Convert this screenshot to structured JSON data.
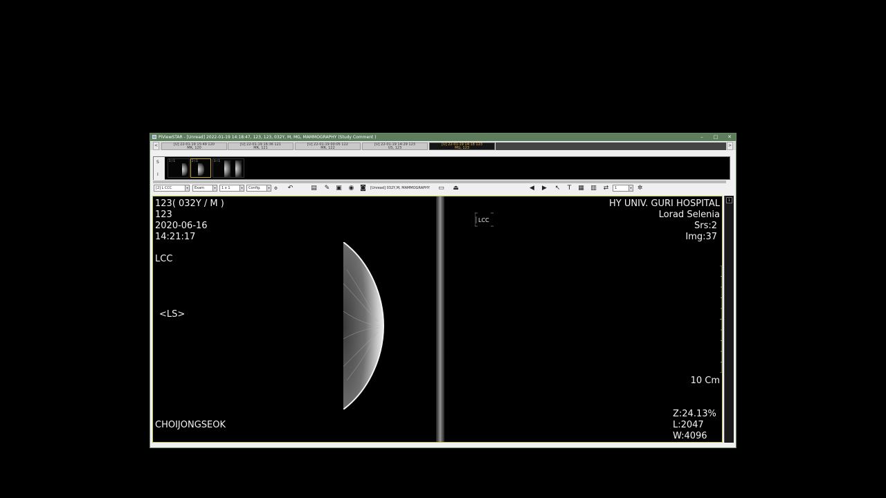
{
  "window": {
    "title": "PiViewSTAR - [Unread] 2022-01-19 14:18:47, 123, 123, 032Y, M, MG, MAMMOGRAPHY  (Study Comment )",
    "minimize": "–",
    "maximize": "□",
    "close": "✕"
  },
  "tabs": [
    {
      "line1": "[U] 22-01-19 15:49  120",
      "line2": "MR, 120",
      "active": false
    },
    {
      "line1": "[U] 22-01-19 16:36  121",
      "line2": "MR, 121",
      "active": false
    },
    {
      "line1": "[U] 22-01-19 00:05  122",
      "line2": "MR, 122",
      "active": false
    },
    {
      "line1": "[U] 22-01-19 14:29  123",
      "line2": "US, 123",
      "active": false
    },
    {
      "line1": "[U] 22-01-19 14:18  123",
      "line2": "MG, 123",
      "active": true
    }
  ],
  "thumbstrip": {
    "side_top": "S",
    "side_bottom": "I",
    "thumbs": [
      {
        "label": "1 / 1"
      },
      {
        "label": "2 / 1"
      },
      {
        "label": "3 / 1"
      }
    ]
  },
  "toolbar": {
    "series_select": "[2] L CCC",
    "exam_select": "Exam",
    "layout_select": "1 x 1",
    "config_select": "Config.",
    "status": "[Unread] 032Y,M, MAMMOGRAPHY",
    "frame_select": "1"
  },
  "viewer": {
    "left": {
      "patient": "123( 032Y / M )",
      "id": "123",
      "date": "2020-06-16",
      "time": "14:21:17",
      "view": "LCC",
      "orientation": "<LS>",
      "operator": "CHOIJONGSEOK"
    },
    "right": {
      "hospital": "HY UNIV. GURI HOSPITAL",
      "device": "Lorad Selenia",
      "series": "Srs:2",
      "image": "Img:37",
      "scale": "10 Cm",
      "zoom": "Z:24.13%",
      "level": "L:2047",
      "width": "W:4096",
      "marker_label": "LCC"
    },
    "page_indicator": "1"
  }
}
